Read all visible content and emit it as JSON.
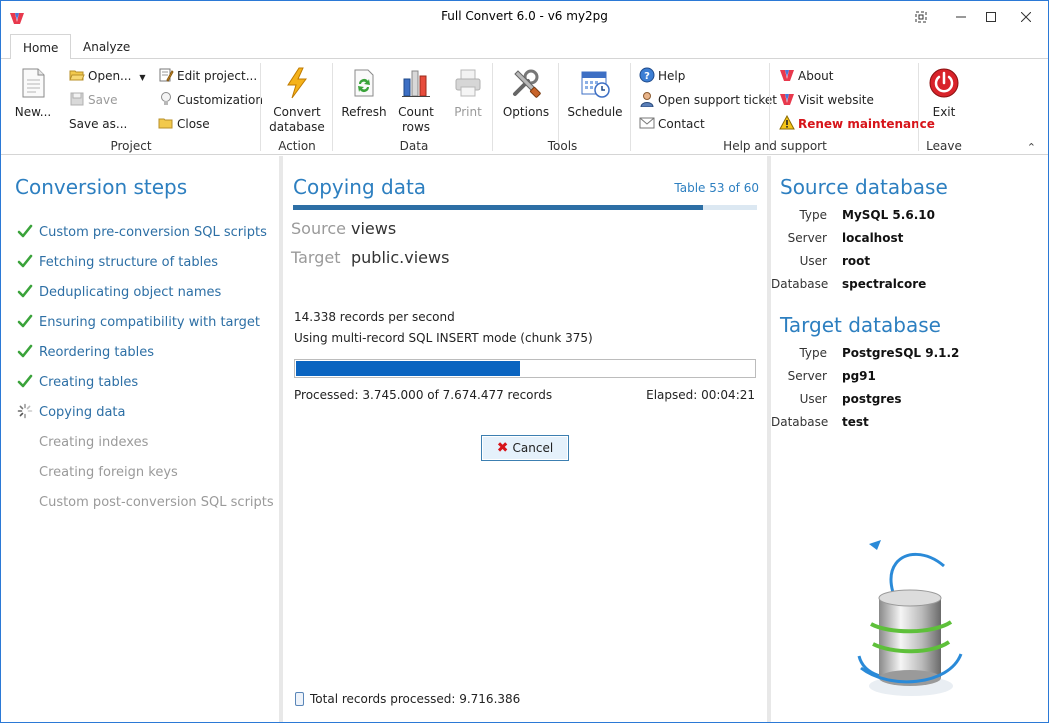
{
  "window": {
    "title": "Full Convert 6.0 - v6 my2pg"
  },
  "tabs": [
    {
      "label": "Home"
    },
    {
      "label": "Analyze"
    }
  ],
  "ribbon": {
    "project": {
      "label": "Project",
      "new_label": "New...",
      "open_label": "Open...",
      "save_label": "Save",
      "saveas_label": "Save as...",
      "edit_label": "Edit project...",
      "customization_label": "Customization",
      "close_label": "Close"
    },
    "action": {
      "label": "Action",
      "convert_line1": "Convert",
      "convert_line2": "database"
    },
    "data": {
      "label": "Data",
      "refresh_label": "Refresh",
      "count_line1": "Count",
      "count_line2": "rows",
      "print_label": "Print"
    },
    "tools": {
      "label": "Tools",
      "options_label": "Options",
      "schedule_label": "Schedule"
    },
    "help": {
      "label": "Help and support",
      "help_label": "Help",
      "ticket_label": "Open support ticket",
      "contact_label": "Contact",
      "about_label": "About",
      "website_label": "Visit website",
      "renew_label": "Renew maintenance"
    },
    "leave": {
      "label": "Leave",
      "exit_label": "Exit"
    }
  },
  "steps": {
    "title": "Conversion steps",
    "items": [
      {
        "label": "Custom pre-conversion SQL scripts",
        "status": "done"
      },
      {
        "label": "Fetching structure of tables",
        "status": "done"
      },
      {
        "label": "Deduplicating object names",
        "status": "done"
      },
      {
        "label": "Ensuring compatibility with target",
        "status": "done"
      },
      {
        "label": "Reordering tables",
        "status": "done"
      },
      {
        "label": "Creating tables",
        "status": "done"
      },
      {
        "label": "Copying data",
        "status": "active"
      },
      {
        "label": "Creating indexes",
        "status": "pending"
      },
      {
        "label": "Creating foreign keys",
        "status": "pending"
      },
      {
        "label": "Custom post-conversion SQL scripts",
        "status": "pending"
      }
    ]
  },
  "copy": {
    "title": "Copying data",
    "table_count": "Table 53 of 60",
    "overall_progress": 0.883,
    "source_label": "Source",
    "source_value": "views",
    "target_label": "Target",
    "target_value": "public.views",
    "rate": "14.338 records per second",
    "mode": "Using multi-record SQL INSERT mode (chunk 375)",
    "record_progress": 0.488,
    "processed": "Processed: 3.745.000 of 7.674.477 records",
    "elapsed": "Elapsed: 00:04:21",
    "cancel_label": "Cancel",
    "total": "Total records processed: 9.716.386"
  },
  "source_db": {
    "title": "Source database",
    "rows": [
      {
        "label": "Type",
        "value": "MySQL 5.6.10"
      },
      {
        "label": "Server",
        "value": "localhost"
      },
      {
        "label": "User",
        "value": "root"
      },
      {
        "label": "Database",
        "value": "spectralcore"
      }
    ]
  },
  "target_db": {
    "title": "Target database",
    "rows": [
      {
        "label": "Type",
        "value": "PostgreSQL 9.1.2"
      },
      {
        "label": "Server",
        "value": "pg91"
      },
      {
        "label": "User",
        "value": "postgres"
      },
      {
        "label": "Database",
        "value": "test"
      }
    ]
  },
  "colors": {
    "accent": "#2d7fc0",
    "progress": "#0a64c0",
    "warning": "#d7141a",
    "check": "#3aa33a"
  }
}
